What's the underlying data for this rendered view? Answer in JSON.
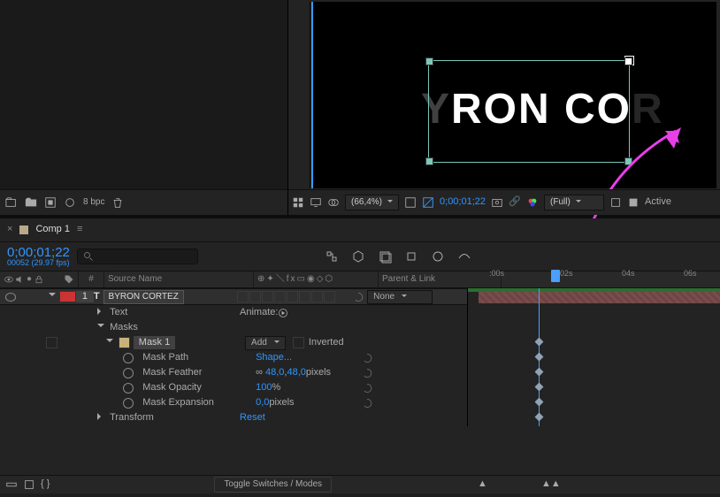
{
  "project_bar": {
    "bpc": "8 bpc"
  },
  "viewer": {
    "text": "YRON COR",
    "zoom": "(66,4%)",
    "timecode": "0;00;01;22",
    "res": "(Full)",
    "status": "Active"
  },
  "comp": {
    "tab": "Comp 1",
    "timecode": "0;00;01;22",
    "fps": "00052 (29.97 fps)"
  },
  "ruler": {
    "t0": ":00s",
    "t1": "02s",
    "t2": "04s",
    "t3": "06s"
  },
  "columns": {
    "num": "#",
    "source": "Source Name",
    "parent": "Parent & Link"
  },
  "layer": {
    "num": "1",
    "name": "BYRON CORTEZ",
    "parent_mode": "None"
  },
  "group_text": "Text",
  "animate": "Animate:",
  "group_masks": "Masks",
  "mask": {
    "name": "Mask 1",
    "mode": "Add",
    "inv": "Inverted"
  },
  "props": {
    "path": {
      "label": "Mask Path",
      "val": "Shape..."
    },
    "feather": {
      "label": "Mask Feather",
      "val": "48,0",
      "val2": "48,0",
      "unit": " pixels"
    },
    "opacity": {
      "label": "Mask Opacity",
      "val": "100",
      "unit": "%"
    },
    "exp": {
      "label": "Mask Expansion",
      "val": "0,0",
      "unit": " pixels"
    }
  },
  "group_transform": "Transform",
  "transform_reset": "Reset",
  "footer": {
    "toggle": "Toggle Switches / Modes"
  }
}
